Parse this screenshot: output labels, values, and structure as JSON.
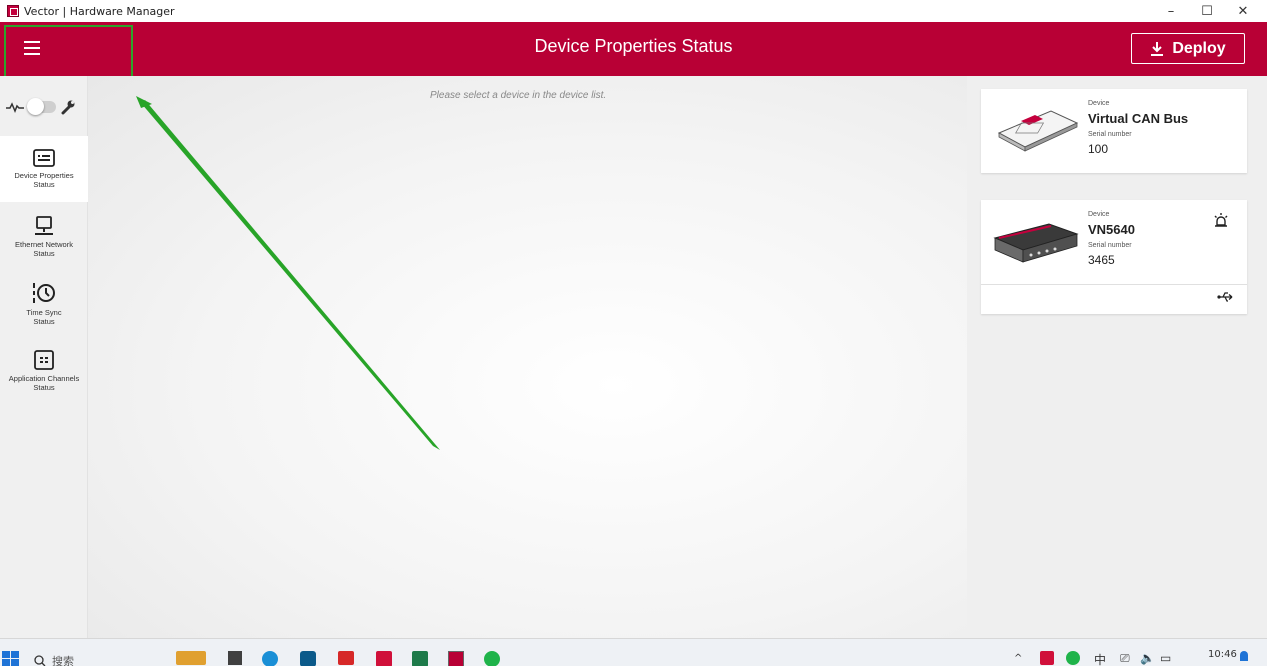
{
  "window": {
    "title": "Vector | Hardware Manager",
    "minimize_symbol": "–",
    "maximize_symbol": "☐",
    "close_symbol": "✕"
  },
  "header": {
    "title": "Device Properties Status",
    "deploy_label": "Deploy"
  },
  "sidebar": {
    "items": [
      {
        "label_line1": "Device Properties",
        "label_line2": "Status",
        "icon": "device-properties-icon",
        "active": true
      },
      {
        "label_line1": "Ethernet Network",
        "label_line2": "Status",
        "icon": "ethernet-network-icon",
        "active": false
      },
      {
        "label_line1": "Time Sync",
        "label_line2": "Status",
        "icon": "time-sync-icon",
        "active": false
      },
      {
        "label_line1": "Application Channels",
        "label_line2": "Status",
        "icon": "application-channels-icon",
        "active": false
      }
    ]
  },
  "main": {
    "placeholder": "Please select a device in the device list."
  },
  "devices": [
    {
      "device_label": "Device",
      "name": "Virtual CAN Bus",
      "serial_label": "Serial number",
      "serial": "100"
    },
    {
      "device_label": "Device",
      "name": "VN5640",
      "serial_label": "Serial number",
      "serial": "3465"
    }
  ],
  "taskbar": {
    "search_placeholder": "搜索",
    "ime": "中",
    "time": "10:46"
  },
  "colors": {
    "brand_red": "#b80035",
    "highlight_green": "#2ba42b",
    "sidebar_bg": "#f0f0f0",
    "panel_bg": "#efefef"
  }
}
